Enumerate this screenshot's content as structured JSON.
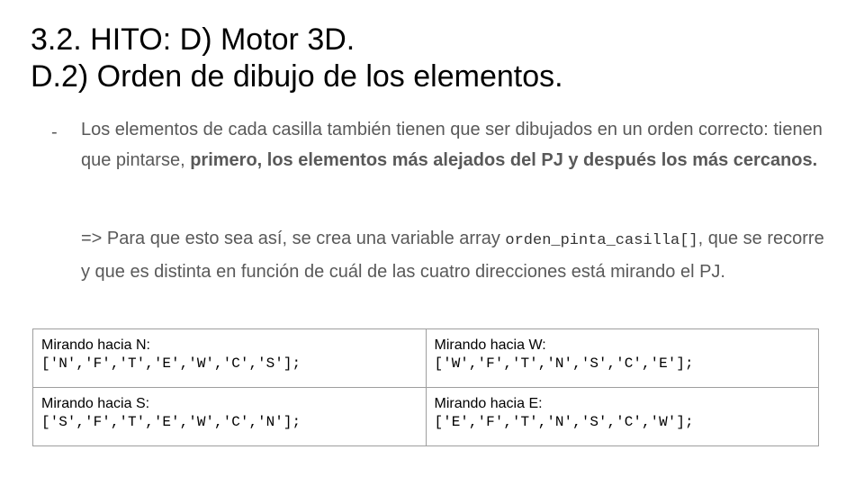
{
  "slide": {
    "title_line1": "3.2. HITO: D) Motor 3D.",
    "title_line2": "D.2) Orden de dibujo de los elementos."
  },
  "bullet": {
    "dash": "-",
    "text_before_bold": "Los elementos de cada casilla también tienen que ser dibujados en un orden correcto: tienen que pintarse, ",
    "bold_text": "primero, los elementos más alejados del PJ y después los más cercanos.",
    "para2_before_code": "=> Para que esto sea así, se crea una variable array ",
    "para2_code": "orden_pinta_casilla[]",
    "para2_after_code": ", que se recorre y que es distinta en función de cuál de las cuatro direcciones está mirando el PJ."
  },
  "table": {
    "rows": [
      [
        {
          "label": "Mirando hacia N:",
          "code": "['N','F','T','E','W','C','S'];"
        },
        {
          "label": "Mirando hacia W:",
          "code": "['W','F','T','N','S','C','E'];"
        }
      ],
      [
        {
          "label": "Mirando hacia S:",
          "code": "['S','F','T','E','W','C','N'];"
        },
        {
          "label": "Mirando hacia E:",
          "code": "['E','F','T','N','S','C','W'];"
        }
      ]
    ]
  }
}
